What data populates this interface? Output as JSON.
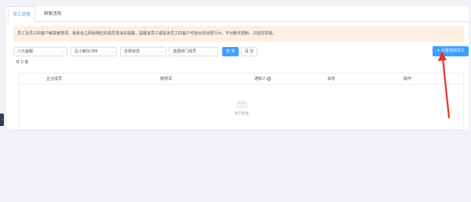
{
  "tabs": [
    {
      "label": "员工违规",
      "active": true
    },
    {
      "label": "群聊违规",
      "active": false
    }
  ],
  "notice": "员工及员工的客户触发敏感词，系统会立即给相应的成员发消息提醒，提醒该员工或是该员工的客户可能出现违规行为，不对聊天限制，只监控举报。",
  "filters": {
    "select1": "八爪鱼服",
    "select2": "企小鲸SCRM",
    "select3": "全部状态",
    "select4": "选择部门成员"
  },
  "buttons": {
    "query": "查 询",
    "clear": "清 空",
    "add": "+ 设置违规员工"
  },
  "total": "共 0 条",
  "table": {
    "columns": [
      "企业成员",
      "敏感词",
      "通知人",
      "状态",
      "操作"
    ],
    "empty_text": "暂无数据"
  },
  "colors": {
    "primary": "#409eff",
    "notice_bg": "#fdf0e3",
    "annotation_arrow": "#e8322b"
  }
}
